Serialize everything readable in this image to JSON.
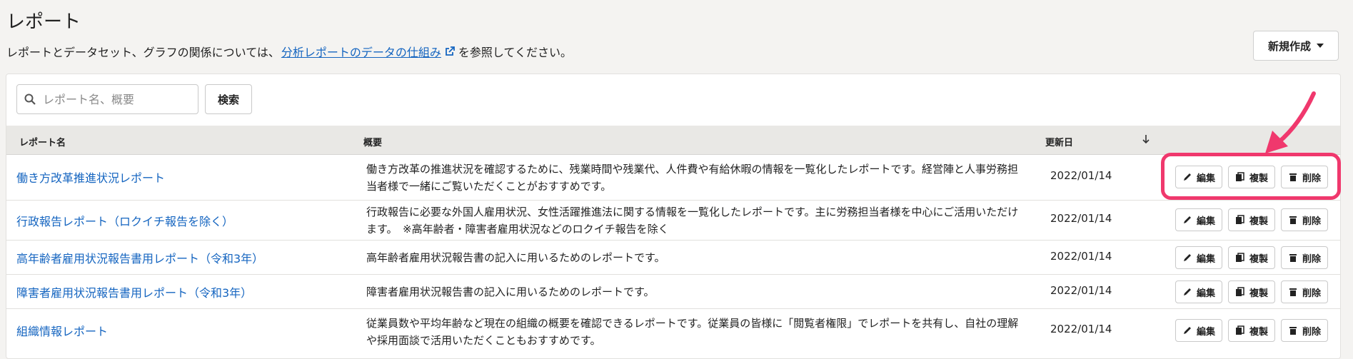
{
  "page": {
    "title": "レポート",
    "description_prefix": "レポートとデータセット、グラフの関係については、",
    "description_link": "分析レポートのデータの仕組み",
    "description_suffix": "を参照してください。",
    "new_button_label": "新規作成"
  },
  "search": {
    "placeholder": "レポート名、概要",
    "value": "",
    "button_label": "検索"
  },
  "table": {
    "headers": {
      "name": "レポート名",
      "summary": "概要",
      "updated": "更新日"
    },
    "actions": {
      "edit": "編集",
      "copy": "複製",
      "delete": "削除"
    },
    "rows": [
      {
        "name": "働き方改革推進状況レポート",
        "summary": "働き方改革の推進状況を確認するために、残業時間や残業代、人件費や有給休暇の情報を一覧化したレポートです。経営陣と人事労務担当者様で一緒にご覧いただくことがおすすめです。",
        "date": "2022/01/14"
      },
      {
        "name": "行政報告レポート（ロクイチ報告を除く）",
        "summary": "行政報告に必要な外国人雇用状況、女性活躍推進法に関する情報を一覧化したレポートです。主に労務担当者様を中心にご活用いただけます。　※高年齢者・障害者雇用状況などのロクイチ報告を除く",
        "date": "2022/01/14"
      },
      {
        "name": "高年齢者雇用状況報告書用レポート（令和3年）",
        "summary": "高年齢者雇用状況報告書の記入に用いるためのレポートです。",
        "date": "2022/01/14"
      },
      {
        "name": "障害者雇用状況報告書用レポート（令和3年）",
        "summary": "障害者雇用状況報告書の記入に用いるためのレポートです。",
        "date": "2022/01/14"
      },
      {
        "name": "組織情報レポート",
        "summary": "従業員数や平均年齢など現在の組織の概要を確認できるレポートです。従業員の皆様に「閲覧者権限」でレポートを共有し、自社の理解や採用面談で活用いただくこともおすすめです。",
        "date": "2022/01/14"
      }
    ]
  },
  "colors": {
    "link": "#1565c0",
    "highlight": "#f0386d",
    "header_bg": "#e9e8e5"
  },
  "icons": {
    "search": "search-icon",
    "external": "external-link-icon",
    "sort": "sort-down-icon",
    "edit": "pencil-icon",
    "copy": "copy-icon",
    "delete": "trash-icon"
  }
}
